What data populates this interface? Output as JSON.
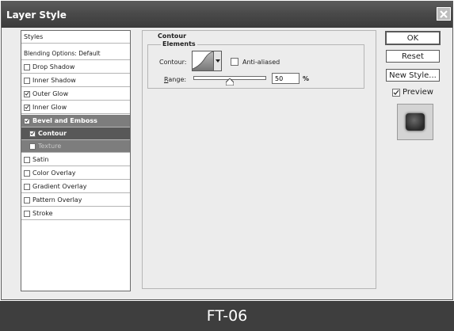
{
  "window": {
    "title": "Layer Style"
  },
  "styles_panel": {
    "header": "Styles",
    "blending_options": "Blending Options: Default",
    "items": [
      {
        "label": "Drop Shadow",
        "checked": false
      },
      {
        "label": "Inner Shadow",
        "checked": false
      },
      {
        "label": "Outer Glow",
        "checked": true
      },
      {
        "label": "Inner Glow",
        "checked": true
      },
      {
        "label": "Bevel and Emboss",
        "checked": true,
        "selected": true
      },
      {
        "label": "Contour",
        "checked": true,
        "selected": true
      },
      {
        "label": "Texture",
        "checked": false
      },
      {
        "label": "Satin",
        "checked": false
      },
      {
        "label": "Color Overlay",
        "checked": false
      },
      {
        "label": "Gradient Overlay",
        "checked": false
      },
      {
        "label": "Pattern Overlay",
        "checked": false
      },
      {
        "label": "Stroke",
        "checked": false
      }
    ]
  },
  "settings": {
    "group_title": "Contour",
    "elements_title": "Elements",
    "contour_label": "Contour:",
    "anti_aliased_label": "Anti-aliased",
    "anti_aliased_checked": false,
    "range_label": "Range:",
    "range_value": "50",
    "range_unit": "%",
    "range_fraction": 0.5
  },
  "buttons": {
    "ok": "OK",
    "reset": "Reset",
    "new_style": "New Style...",
    "preview": "Preview",
    "preview_checked": true
  },
  "caption": "FT-06"
}
